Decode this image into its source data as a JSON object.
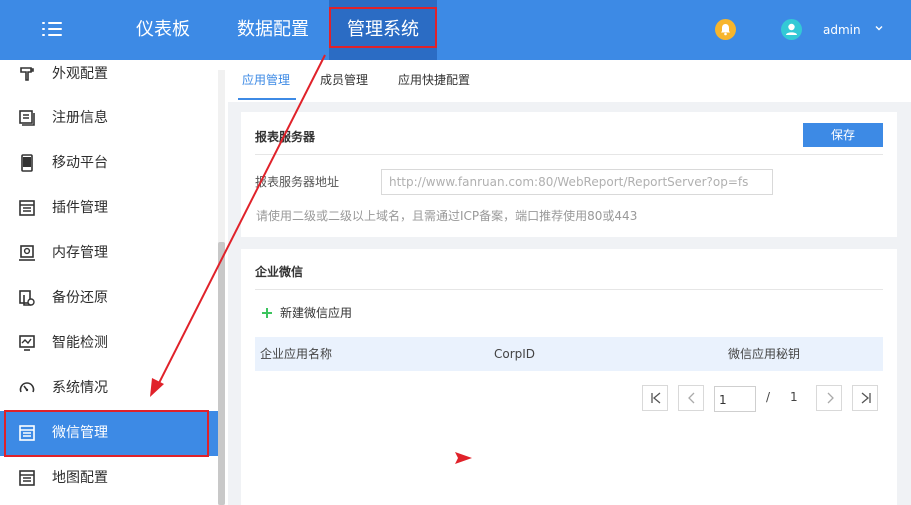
{
  "topbar": {
    "nav": [
      "仪表板",
      "数据配置",
      "管理系统"
    ],
    "user": "admin"
  },
  "sidebar": {
    "items": [
      {
        "label": "外观配置",
        "icon": "appearance-icon"
      },
      {
        "label": "注册信息",
        "icon": "register-icon"
      },
      {
        "label": "移动平台",
        "icon": "mobile-icon"
      },
      {
        "label": "插件管理",
        "icon": "plugin-icon"
      },
      {
        "label": "内存管理",
        "icon": "memory-icon"
      },
      {
        "label": "备份还原",
        "icon": "backup-icon"
      },
      {
        "label": "智能检测",
        "icon": "monitor-icon"
      },
      {
        "label": "系统情况",
        "icon": "gauge-icon"
      },
      {
        "label": "微信管理",
        "icon": "wechat-manage-icon"
      },
      {
        "label": "地图配置",
        "icon": "map-icon"
      }
    ],
    "active_index": 8
  },
  "tabs": [
    "应用管理",
    "成员管理",
    "应用快捷配置"
  ],
  "report_server": {
    "title": "报表服务器",
    "save_label": "保存",
    "field_label": "报表服务器地址",
    "placeholder": "http://www.fanruan.com:80/WebReport/ReportServer?op=fs",
    "hint": "请使用二级或二级以上域名，且需通过ICP备案，端口推荐使用80或443"
  },
  "wechat": {
    "title": "企业微信",
    "new_app_label": "新建微信应用",
    "columns": [
      "企业应用名称",
      "CorpID",
      "微信应用秘钥"
    ],
    "pagination": {
      "current": "1",
      "separator": "/",
      "total": "1"
    }
  },
  "colors": {
    "primary": "#3d8ae5",
    "annotation": "#e0222a"
  }
}
